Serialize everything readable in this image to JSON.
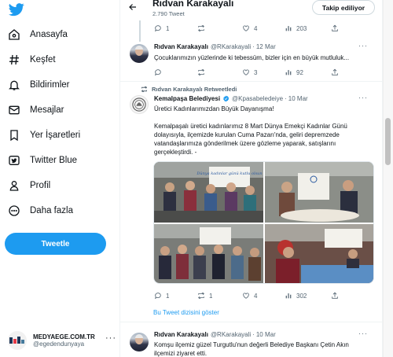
{
  "brand": {
    "logo_icon": "twitter-bird-icon",
    "color": "#1d9bf0"
  },
  "nav": [
    {
      "label": "Anasayfa",
      "icon": "home-icon"
    },
    {
      "label": "Keşfet",
      "icon": "hashtag-icon"
    },
    {
      "label": "Bildirimler",
      "icon": "bell-icon"
    },
    {
      "label": "Mesajlar",
      "icon": "mail-icon"
    },
    {
      "label": "Yer İşaretleri",
      "icon": "bookmark-icon"
    },
    {
      "label": "Twitter Blue",
      "icon": "twitter-blue-icon"
    },
    {
      "label": "Profil",
      "icon": "person-icon"
    },
    {
      "label": "Daha fazla",
      "icon": "more-circle-icon"
    }
  ],
  "tweet_button": {
    "label": "Tweetle"
  },
  "account": {
    "name": "MEDYAEGE.COM.TR",
    "handle": "@egedendunyaya",
    "more": "···"
  },
  "header": {
    "title": "Rıdvan Karakayalı",
    "subtitle": "2.790 Tweet",
    "follow_label": "Takip ediliyor"
  },
  "top_actions": {
    "reply": "1",
    "retweet": "",
    "like": "4",
    "views": "203"
  },
  "tweet1": {
    "name": "Rıdvan Karakayalı",
    "handle": "@RKarakayali",
    "dot": "·",
    "date": "12 Mar",
    "text": "Çocuklarımızın yüzlerinde ki tebessüm, bizler için en büyük mutluluk...",
    "more": "···",
    "actions": {
      "reply": "",
      "retweet": "",
      "like": "3",
      "views": "92"
    }
  },
  "tweet2": {
    "retweeted_by": "Rıdvan Karakayalı Retweetledi",
    "name": "Kemalpaşa Belediyesi",
    "handle": "@Kpasabeledeiye",
    "dot": "·",
    "date": "10 Mar",
    "more": "···",
    "headline": "Üretici Kadınlarımızdan Büyük Dayanışma!",
    "body_lines": [
      "Kemalpaşalı üretici kadınlarımız 8 Mart Dünya Emekçi Kadınlar Günü",
      "dolayısıyla, ilçemizde kurulan Cuma Pazarı'nda, geliri depremzede",
      "vatandaşlarımıza gönderilmek üzere gözleme yaparak, satışlarını",
      "gerçekleştirdi. -"
    ],
    "photo_banner": "Dünya kadınlar günü kutlu olsun",
    "actions": {
      "reply": "1",
      "retweet": "1",
      "like": "4",
      "views": "302"
    },
    "show_thread": "Bu Tweet dizisini göster"
  },
  "tweet3": {
    "name": "Rıdvan Karakayalı",
    "handle": "@RKarakayali",
    "dot": "·",
    "date": "10 Mar",
    "more": "···",
    "text_lines": [
      "Komşu ilçemiz güzel Turgutlu'nun değerli Belediye Başkanı Çetin Akın",
      "ilçemizi ziyaret etti."
    ]
  },
  "colors": {
    "accent": "#1d9bf0",
    "text": "#0f1419",
    "muted": "#536471",
    "border": "#eff3f4"
  }
}
